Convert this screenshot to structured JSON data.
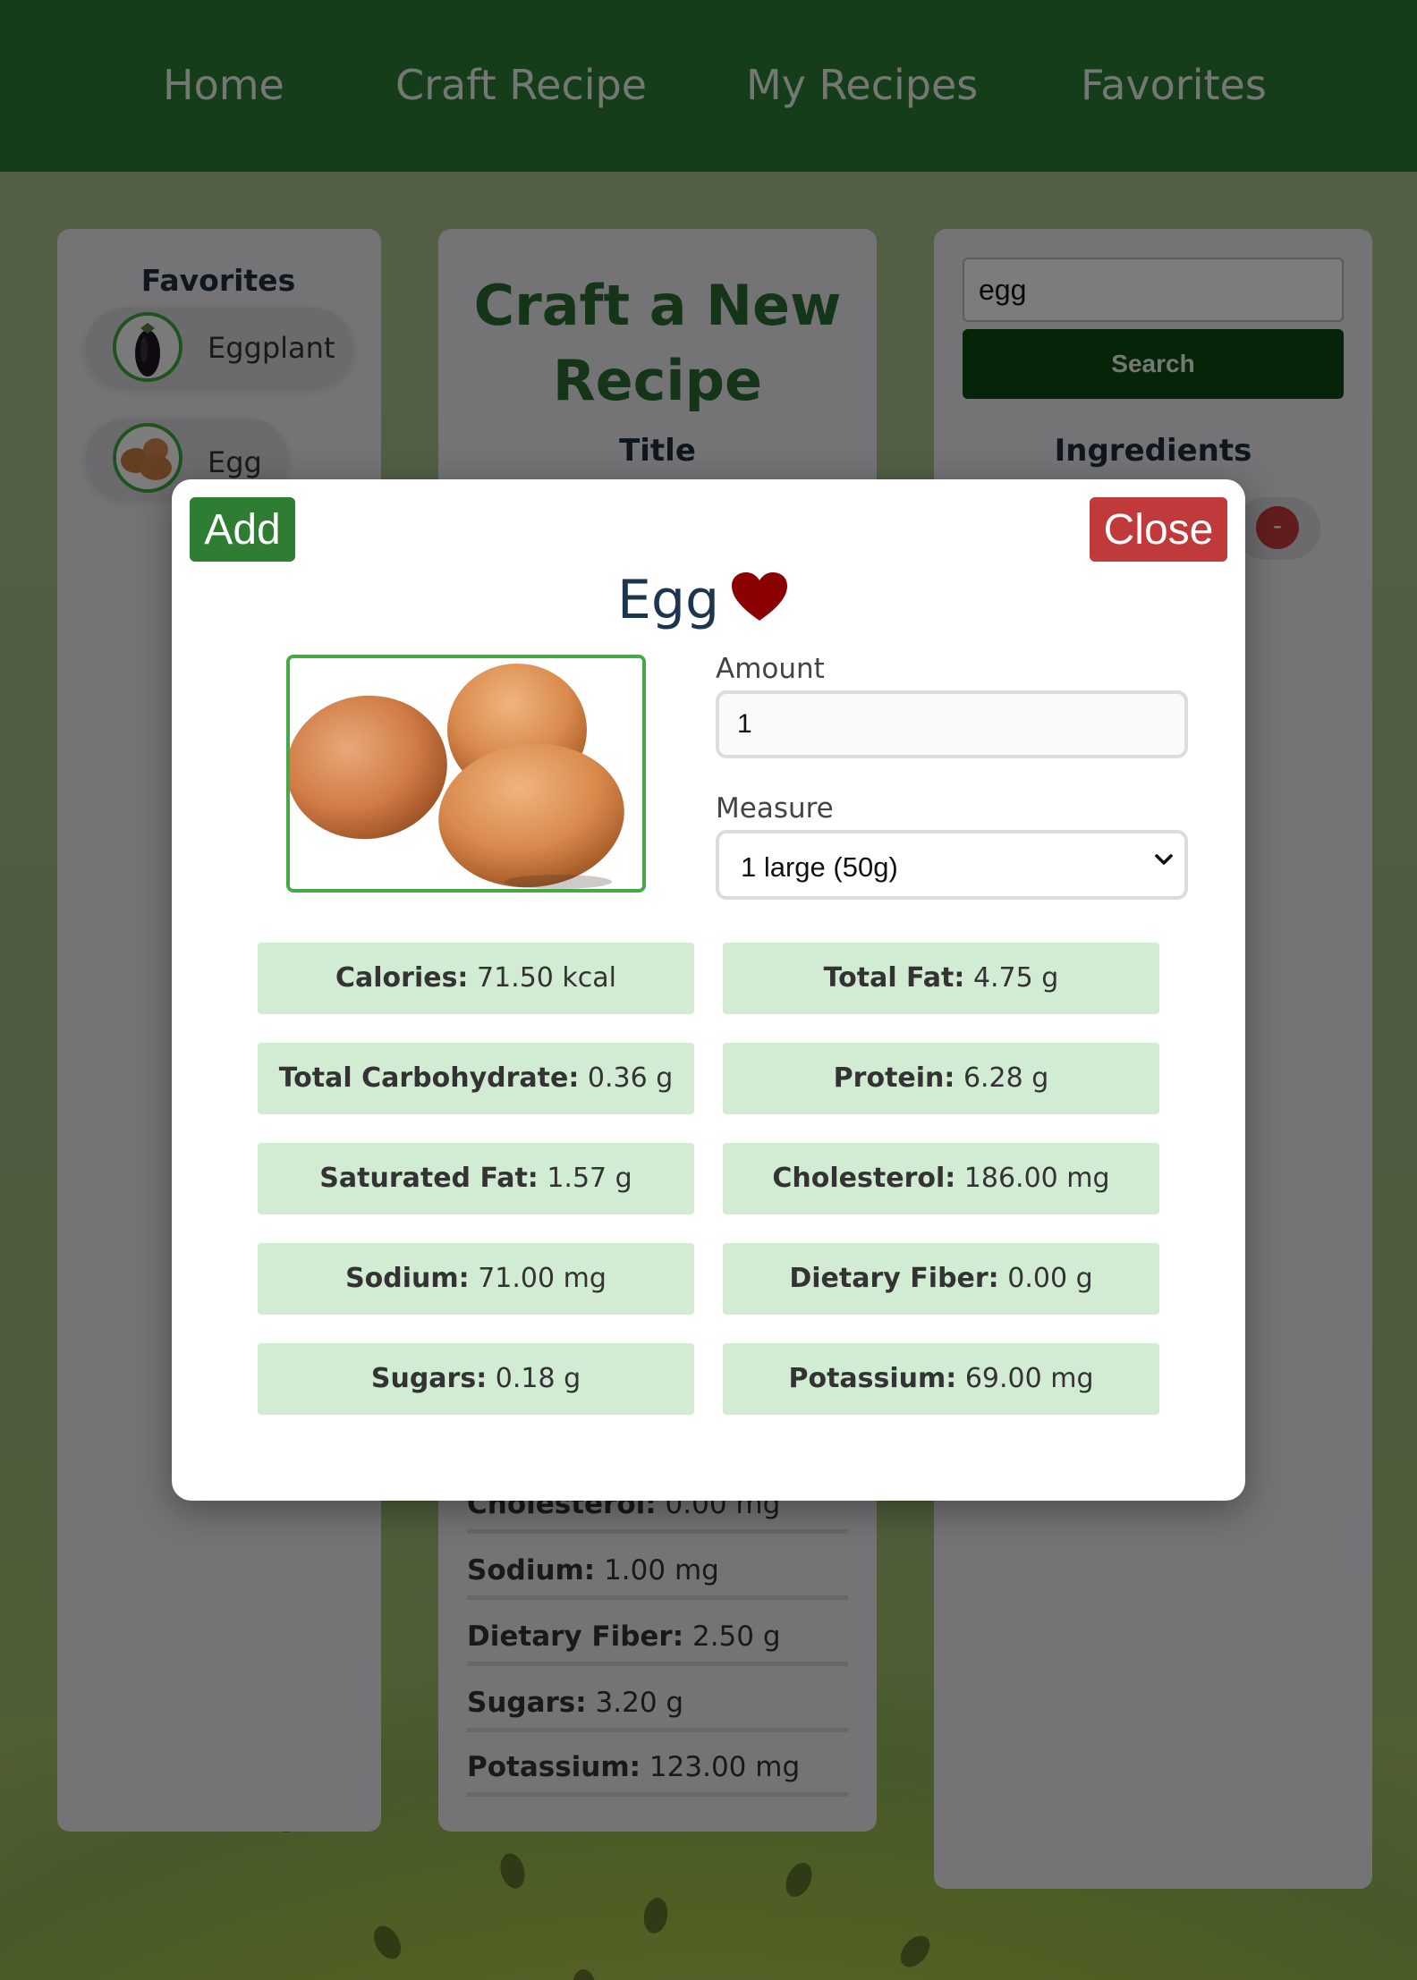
{
  "nav": {
    "items": [
      {
        "label": "Home"
      },
      {
        "label": "Craft Recipe"
      },
      {
        "label": "My Recipes"
      },
      {
        "label": "Favorites"
      }
    ]
  },
  "favorites": {
    "title": "Favorites",
    "items": [
      {
        "label": "Eggplant"
      },
      {
        "label": "Egg"
      }
    ]
  },
  "craft": {
    "title_line1": "Craft a New",
    "title_line2": "Recipe",
    "subtitle": "Title",
    "nutrients": [
      {
        "name": "Cholesterol:",
        "value": "0.00 mg"
      },
      {
        "name": "Sodium:",
        "value": "1.00 mg"
      },
      {
        "name": "Dietary Fiber:",
        "value": "2.50 g"
      },
      {
        "name": "Sugars:",
        "value": "3.20 g"
      },
      {
        "name": "Potassium:",
        "value": "123.00 mg"
      }
    ]
  },
  "search": {
    "value": "egg",
    "button_label": "Search"
  },
  "ingredients": {
    "title": "Ingredients",
    "remove_label": "-"
  },
  "modal": {
    "add_label": "Add",
    "close_label": "Close",
    "title": "Egg",
    "amount_label": "Amount",
    "amount_value": "1",
    "measure_label": "Measure",
    "measure_value": "1 large (50g)",
    "nutrients": [
      {
        "name": "Calories:",
        "value": "71.50 kcal"
      },
      {
        "name": "Total Fat:",
        "value": "4.75 g"
      },
      {
        "name": "Total Carbohydrate:",
        "value": "0.36 g"
      },
      {
        "name": "Protein:",
        "value": "6.28 g"
      },
      {
        "name": "Saturated Fat:",
        "value": "1.57 g"
      },
      {
        "name": "Cholesterol:",
        "value": "186.00 mg"
      },
      {
        "name": "Sodium:",
        "value": "71.00 mg"
      },
      {
        "name": "Dietary Fiber:",
        "value": "0.00 g"
      },
      {
        "name": "Sugars:",
        "value": "0.18 g"
      },
      {
        "name": "Potassium:",
        "value": "69.00 mg"
      }
    ]
  },
  "colors": {
    "nav_bg": "#2d7a33",
    "add_button": "#2e7d32",
    "close_button": "#c0393b",
    "heart": "#8b0000",
    "nutrient_box": "#d2ebd3",
    "search_button": "#0d4a10"
  },
  "icons": {
    "favorite": "heart-icon",
    "dropdown": "chevron-down-icon"
  }
}
